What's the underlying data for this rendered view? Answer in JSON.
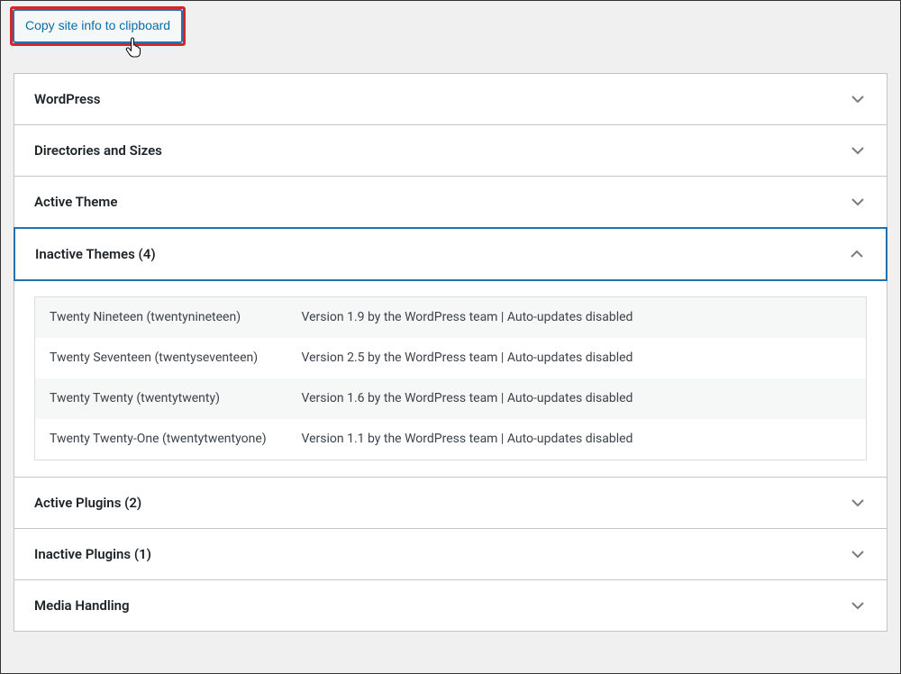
{
  "top": {
    "copy_button_label": "Copy site info to clipboard"
  },
  "panels": {
    "wordpress": {
      "title": "WordPress"
    },
    "directories": {
      "title": "Directories and Sizes"
    },
    "active_theme": {
      "title": "Active Theme"
    },
    "inactive_themes": {
      "title": "Inactive Themes (4)",
      "rows": [
        {
          "name": "Twenty Nineteen (twentynineteen)",
          "desc": "Version 1.9 by the WordPress team | Auto-updates disabled"
        },
        {
          "name": "Twenty Seventeen (twentyseventeen)",
          "desc": "Version 2.5 by the WordPress team | Auto-updates disabled"
        },
        {
          "name": "Twenty Twenty (twentytwenty)",
          "desc": "Version 1.6 by the WordPress team | Auto-updates disabled"
        },
        {
          "name": "Twenty Twenty-One (twentytwentyone)",
          "desc": "Version 1.1 by the WordPress team | Auto-updates disabled"
        }
      ]
    },
    "active_plugins": {
      "title": "Active Plugins (2)"
    },
    "inactive_plugins": {
      "title": "Inactive Plugins (1)"
    },
    "media_handling": {
      "title": "Media Handling"
    }
  }
}
